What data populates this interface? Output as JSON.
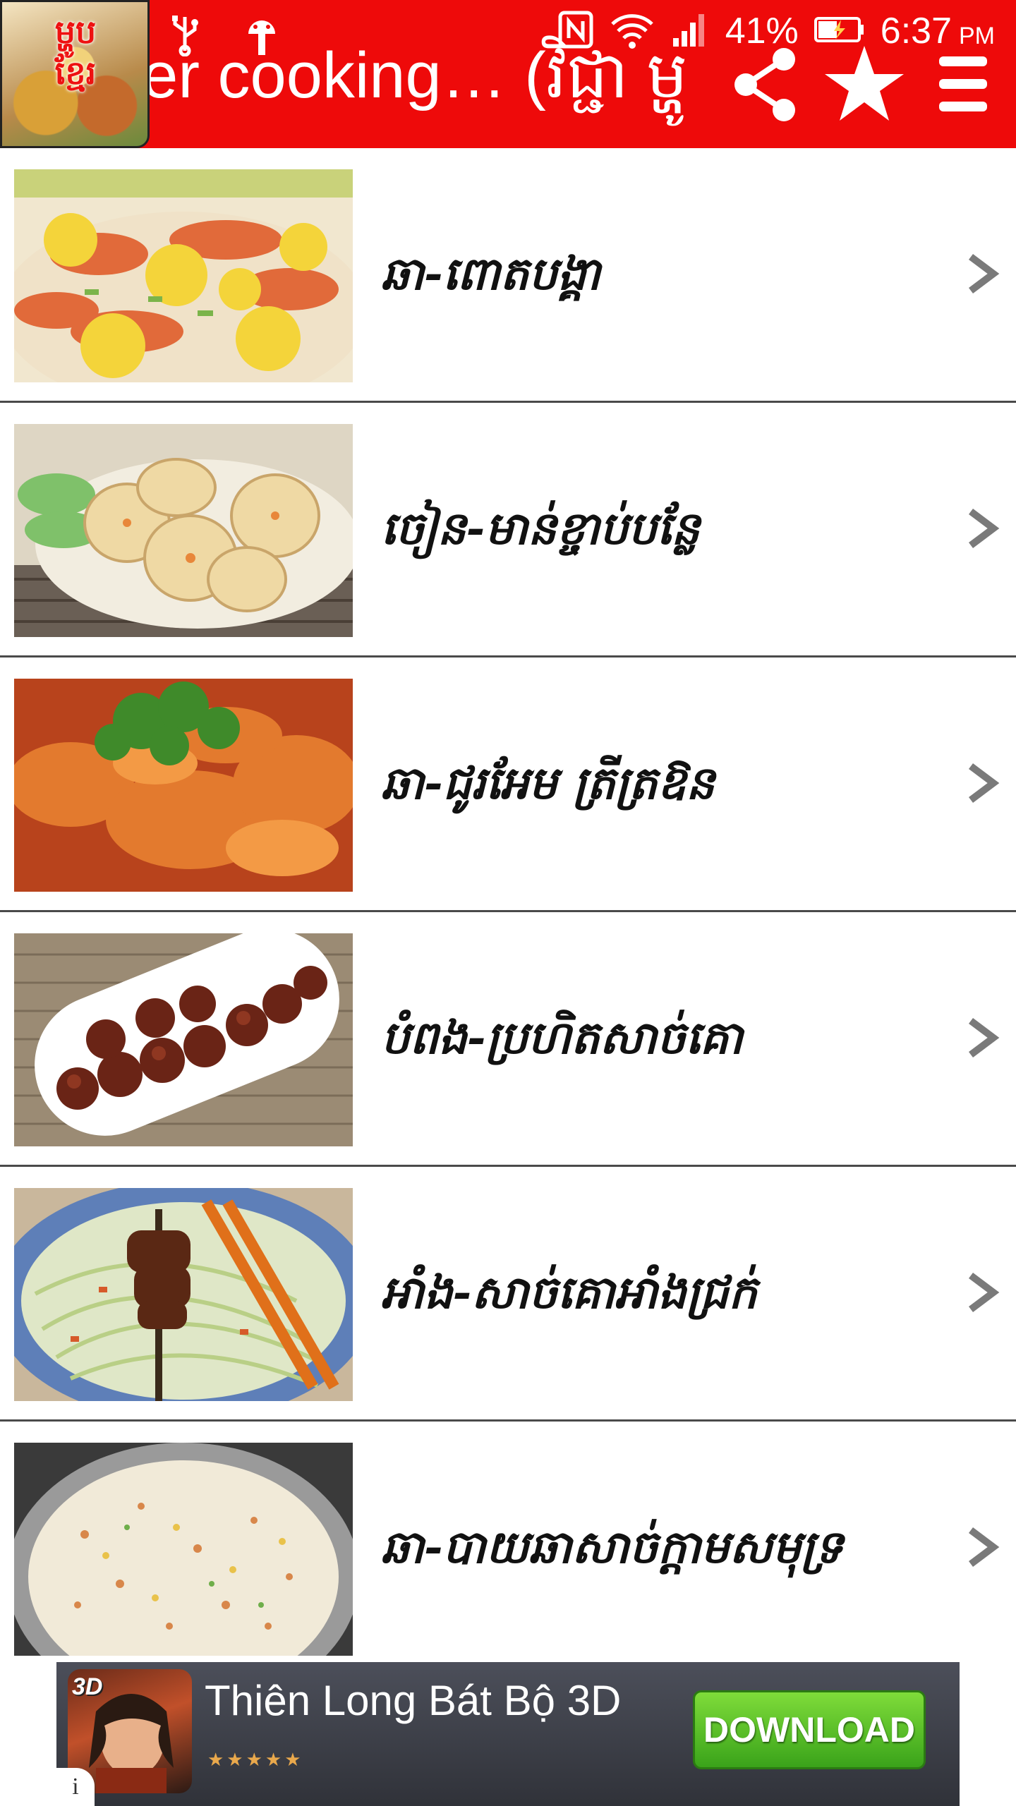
{
  "status_bar": {
    "battery_percent": "41%",
    "time": "6:37",
    "ampm": "PM"
  },
  "app": {
    "logo_text_line1": "ម្ហូប",
    "logo_text_line2": "ខ្មែរ",
    "title": "ner cooking… (វិជ្ជា ម្ហូ",
    "accent_color": "#ee0a0a",
    "actions": [
      "share-icon",
      "star-icon",
      "menu-icon"
    ]
  },
  "recipes": [
    {
      "label": "ឆា-ពោតបង្គា",
      "thumb": "shrimp-corn"
    },
    {
      "label": "ចៀន-មាន់ខ្ចាប់បន្លែ",
      "thumb": "chicken-rolls"
    },
    {
      "label": "ឆា-ជូរអែម ត្រីត្រឱន",
      "thumb": "sweet-sour-fish"
    },
    {
      "label": "បំពង-ប្រហិតសាច់គោ",
      "thumb": "beef-meatballs"
    },
    {
      "label": "អាំង-សាច់គោអាំងជ្រក់",
      "thumb": "grilled-beef-skewer"
    },
    {
      "label": "ឆា-បាយឆាសាច់ក្តាមសមុទ្រ",
      "thumb": "crab-fried-rice"
    }
  ],
  "ad": {
    "icon_tag": "3D",
    "title": "Thiên Long Bát Bộ 3D",
    "rating": "★★★★★",
    "button_label": "DOWNLOAD",
    "info_label": "i"
  }
}
